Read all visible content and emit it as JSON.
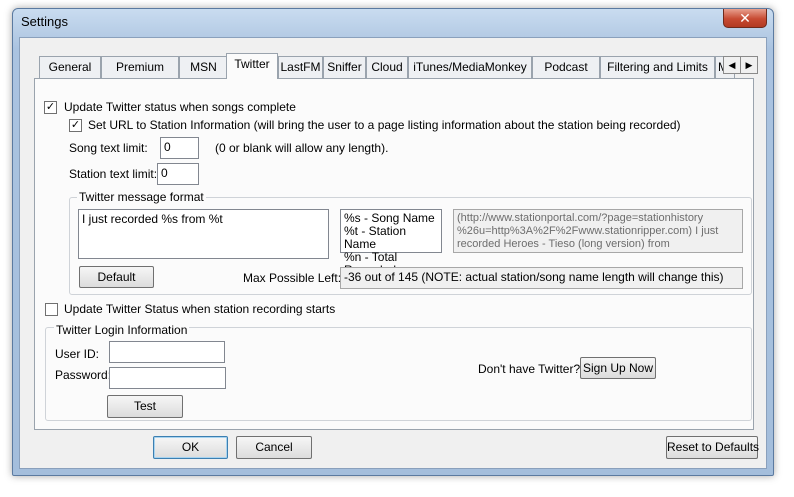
{
  "window": {
    "title": "Settings",
    "close_symbol": "✕"
  },
  "tabs": [
    {
      "label": "General"
    },
    {
      "label": "Premium"
    },
    {
      "label": "MSN"
    },
    {
      "label": "Twitter"
    },
    {
      "label": "LastFM"
    },
    {
      "label": "Sniffer"
    },
    {
      "label": "Cloud"
    },
    {
      "label": "iTunes/MediaMonkey"
    },
    {
      "label": "Podcast"
    },
    {
      "label": "Filtering and Limits"
    },
    {
      "label": "Mus"
    }
  ],
  "active_tab": "Twitter",
  "tab_scroll": {
    "left": "◀",
    "right": "▶"
  },
  "twitter": {
    "update_status_label": "Update Twitter status when songs complete",
    "update_status_checked": "✓",
    "set_url_label": "Set URL to Station Information (will bring the user to a page listing information about the station being recorded)",
    "set_url_checked": "✓",
    "song_limit_label": "Song text limit:",
    "song_limit_value": "0",
    "song_limit_hint": "(0 or blank will allow any length).",
    "station_limit_label": "Station text limit:",
    "station_limit_value": "0",
    "message_format": {
      "title": "Twitter message format",
      "value": "I just recorded %s from %t",
      "legend_line1": "%s - Song Name",
      "legend_line2": "%t - Station Name",
      "legend_line3": "%n - Total Recorded",
      "preview_line1": "(http://www.stationportal.com/?page=stationhistory",
      "preview_line2": "%26u=http%3A%2F%2Fwww.stationripper.com) I just",
      "preview_line3": "recorded Heroes - Tieso (long version) from AfterHoursDJ's -",
      "default_button": "Default",
      "max_left_label": "Max Possible Left:",
      "max_left_value": "-36 out of 145 (NOTE: actual station/song name length will change this)"
    },
    "update_on_start_label": "Update Twitter Status when station recording starts",
    "login": {
      "title": "Twitter Login Information",
      "user_label": "User ID:",
      "user_value": "",
      "password_label": "Password:",
      "password_value": "",
      "test_button": "Test",
      "no_account_text": "Don't have Twitter?",
      "signup_button": "Sign Up Now"
    }
  },
  "footer": {
    "ok": "OK",
    "cancel": "Cancel",
    "reset": "Reset to Defaults"
  },
  "colors": {
    "frame": "#a4bedc",
    "close": "#c74a32",
    "panel": "#fbfbfb"
  }
}
